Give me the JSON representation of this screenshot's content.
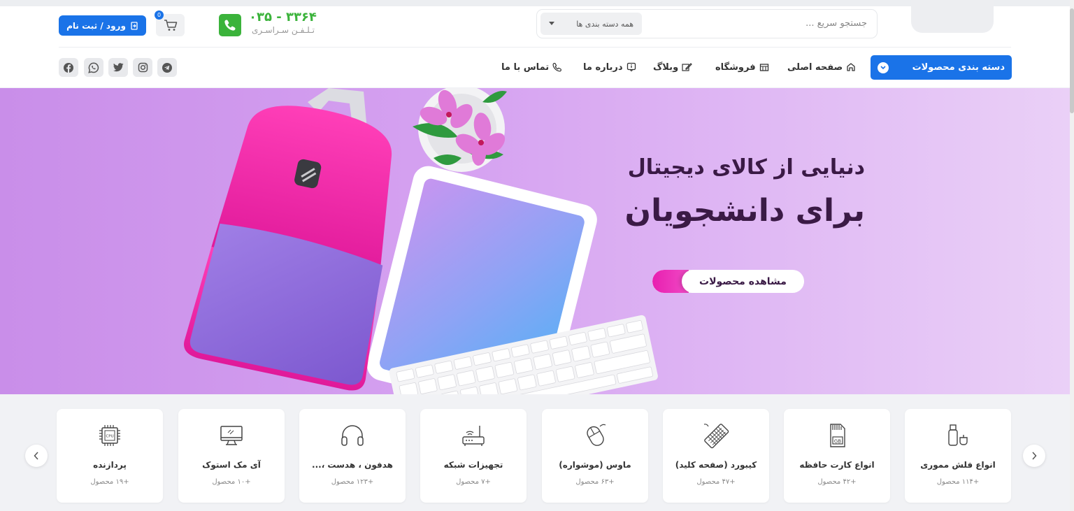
{
  "header": {
    "login_label": "ورود / ثبت نام",
    "cart_count": "0",
    "phone_number": "۰۳۵ - ۳۳۶۴",
    "phone_caption": "تـلـفـن سـراسـری",
    "search_placeholder": "جستجو سریع ...",
    "category_select": "همه دسته بندی ها"
  },
  "nav": {
    "categories_button": "دسته بندی محصولات",
    "items": [
      {
        "label": "صفحه اصلی",
        "icon": "home-icon"
      },
      {
        "label": "فروشگاه",
        "icon": "store-icon"
      },
      {
        "label": "وبلاگ",
        "icon": "edit-icon"
      },
      {
        "label": "درباره ما",
        "icon": "info-icon"
      },
      {
        "label": "تماس با ما",
        "icon": "phone-icon"
      }
    ],
    "social": [
      "telegram-icon",
      "instagram-icon",
      "twitter-icon",
      "whatsapp-icon",
      "facebook-icon"
    ]
  },
  "hero": {
    "line1": "دنیایی از کالای دیجیتال",
    "line2": "برای دانشجویان",
    "cta": "مشاهده محصولات"
  },
  "categories": [
    {
      "title": "انواع فلش مموری",
      "count": "+۱۱۴ محصول",
      "icon": "usb-flash-icon"
    },
    {
      "title": "انواع کارت حافظه",
      "count": "+۴۲ محصول",
      "icon": "memory-card-icon"
    },
    {
      "title": "کیبورد (صفحه کلید)",
      "count": "+۴۷ محصول",
      "icon": "keyboard-icon"
    },
    {
      "title": "ماوس (موشواره)",
      "count": "+۶۳ محصول",
      "icon": "mouse-icon"
    },
    {
      "title": "تجهیزات شبکه",
      "count": "+۷ محصول",
      "icon": "router-icon"
    },
    {
      "title": "هدفون ، هدست ،...",
      "count": "+۱۲۳ محصول",
      "icon": "headphones-icon"
    },
    {
      "title": "آی مک استوک",
      "count": "+۱۰ محصول",
      "icon": "monitor-icon"
    },
    {
      "title": "پردازنده",
      "count": "+۱۹ محصول",
      "icon": "cpu-icon"
    }
  ],
  "colors": {
    "primary": "#1a73e8",
    "phone_green": "#3bb33b",
    "hero_purple": "#d6a3f1",
    "cta_pink": "#e81fb0"
  }
}
